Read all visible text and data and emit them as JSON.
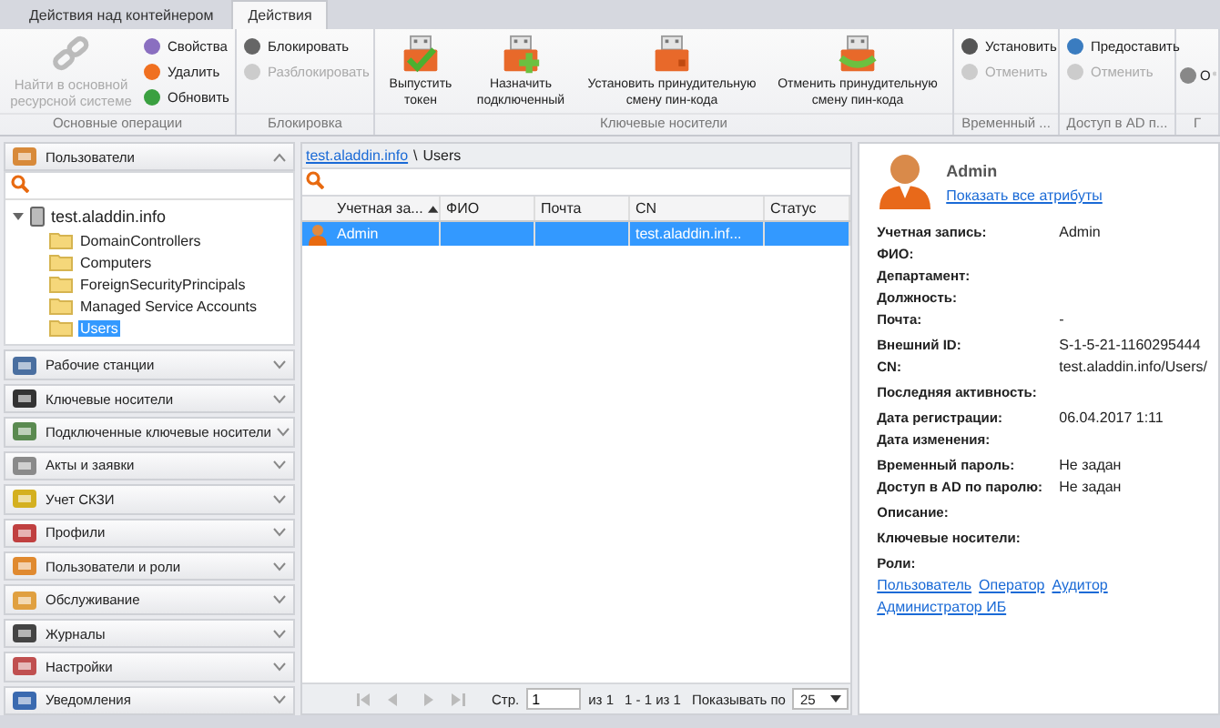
{
  "tabs": [
    {
      "label": "Действия над контейнером",
      "selected": false
    },
    {
      "label": "Действия",
      "selected": true
    }
  ],
  "ribbon": {
    "groups": [
      {
        "title": "Основные операции",
        "large": [
          {
            "label": "Найти в основной ресурсной системе",
            "disabled": true
          }
        ],
        "small": [
          {
            "label": "Свойства",
            "disabled": false
          },
          {
            "label": "Удалить",
            "disabled": false
          },
          {
            "label": "Обновить",
            "disabled": false
          }
        ]
      },
      {
        "title": "Блокировка",
        "small": [
          {
            "label": "Блокировать",
            "disabled": false
          },
          {
            "label": "Разблокировать",
            "disabled": true
          }
        ]
      },
      {
        "title": "Ключевые носители",
        "large": [
          {
            "label": "Выпустить токен",
            "disabled": false
          },
          {
            "label": "Назначить подключенный",
            "disabled": false
          },
          {
            "label": "Установить принудительную смену пин-кода",
            "disabled": false
          },
          {
            "label": "Отменить принудительную смену пин-кода",
            "disabled": false
          }
        ]
      },
      {
        "title": "Временный ...",
        "small": [
          {
            "label": "Установить",
            "disabled": false
          },
          {
            "label": "Отменить",
            "disabled": true
          }
        ]
      },
      {
        "title": "Доступ в AD п...",
        "small": [
          {
            "label": "Предоставить",
            "disabled": false
          },
          {
            "label": "Отменить",
            "disabled": true
          }
        ]
      },
      {
        "title": "Г",
        "small": [
          {
            "label": "О",
            "disabled": false
          }
        ]
      }
    ]
  },
  "sidebar": {
    "panels": [
      {
        "label": "Пользователи",
        "expanded": true
      },
      {
        "label": "Рабочие станции",
        "expanded": false
      },
      {
        "label": "Ключевые носители",
        "expanded": false
      },
      {
        "label": "Подключенные ключевые носители",
        "expanded": false
      },
      {
        "label": "Акты и заявки",
        "expanded": false
      },
      {
        "label": "Учет СКЗИ",
        "expanded": false
      },
      {
        "label": "Профили",
        "expanded": false
      },
      {
        "label": "Пользователи и роли",
        "expanded": false
      },
      {
        "label": "Обслуживание",
        "expanded": false
      },
      {
        "label": "Журналы",
        "expanded": false
      },
      {
        "label": "Настройки",
        "expanded": false
      },
      {
        "label": "Уведомления",
        "expanded": false
      }
    ],
    "tree": {
      "label": "test.aladdin.info",
      "expanded": true,
      "children": [
        {
          "label": "DomainControllers",
          "selected": false
        },
        {
          "label": "Computers",
          "selected": false
        },
        {
          "label": "ForeignSecurityPrincipals",
          "selected": false
        },
        {
          "label": "Managed Service Accounts",
          "selected": false
        },
        {
          "label": "Users",
          "selected": true
        }
      ]
    }
  },
  "breadcrumb": {
    "link": "test.aladdin.info",
    "separator": "\\",
    "current": "Users"
  },
  "table": {
    "columns": [
      {
        "label": "Учетная за...",
        "sorted": true
      },
      {
        "label": "ФИО",
        "sorted": false
      },
      {
        "label": "Почта",
        "sorted": false
      },
      {
        "label": "CN",
        "sorted": false
      },
      {
        "label": "Статус",
        "sorted": false
      }
    ],
    "rows": [
      {
        "selected": true,
        "cells": [
          "Admin",
          "",
          "",
          "test.aladdin.inf...",
          ""
        ]
      }
    ]
  },
  "pager": {
    "page_label": "Стр.",
    "page": "1",
    "page_count": "из 1",
    "range": "1 - 1 из 1",
    "per_page_label": "Показывать по",
    "per_page": "25"
  },
  "details": {
    "name": "Admin",
    "link": "Показать все атрибуты",
    "groups": [
      [
        {
          "label": "Учетная запись:",
          "value": "Admin"
        },
        {
          "label": "ФИО:"
        },
        {
          "label": "Департамент:"
        },
        {
          "label": "Должность:"
        },
        {
          "label": "Почта:",
          "value": "-"
        }
      ],
      [
        {
          "label": "Внешний ID:",
          "value": "S-1-5-21-1160295444"
        },
        {
          "label": "CN:",
          "value": "test.aladdin.info/Users/"
        }
      ],
      [
        {
          "label": "Последняя активность:"
        }
      ],
      [
        {
          "label": "Дата регистрации:",
          "value": "06.04.2017 1:11"
        },
        {
          "label": "Дата изменения:"
        }
      ],
      [
        {
          "label": "Временный пароль:",
          "value": "Не задан"
        },
        {
          "label": "Доступ в AD по паролю:",
          "value": "Не задан"
        }
      ],
      [
        {
          "label": "Описание:"
        }
      ],
      [
        {
          "label": "Ключевые носители:"
        }
      ],
      [
        {
          "label": "Роли:"
        }
      ]
    ],
    "roles": [
      "Пользователь",
      "Оператор",
      "Аудитор",
      "Администратор ИБ"
    ]
  }
}
